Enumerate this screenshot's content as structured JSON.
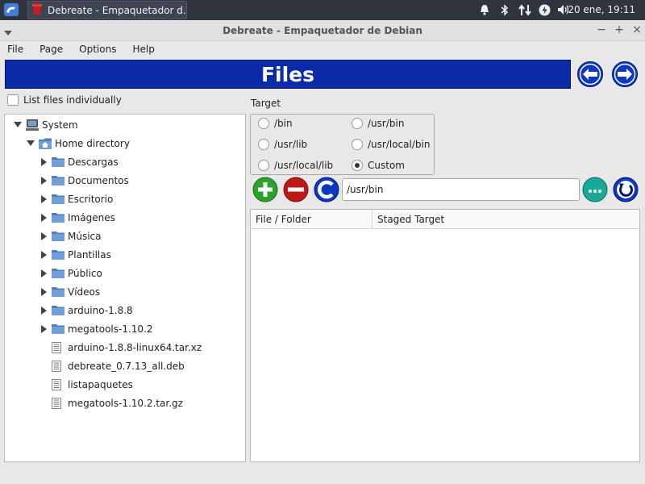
{
  "panel": {
    "task_label": "Debreate - Empaquetador d...",
    "clock": "20 ene, 19:11"
  },
  "window": {
    "title": "Debreate - Empaquetador de Debian",
    "minimize": "−",
    "maximize": "+",
    "close": "×"
  },
  "menubar": {
    "items": [
      "File",
      "Page",
      "Options",
      "Help"
    ]
  },
  "banner": {
    "title": "Files"
  },
  "options": {
    "list_individually": "List files individually"
  },
  "tree": {
    "items": [
      {
        "label": "System",
        "type": "computer",
        "arrow": "expanded"
      },
      {
        "label": "Home directory",
        "type": "home",
        "arrow": "expanded"
      },
      {
        "label": "Descargas",
        "type": "folder",
        "arrow": "collapsed"
      },
      {
        "label": "Documentos",
        "type": "folder",
        "arrow": "collapsed"
      },
      {
        "label": "Escritorio",
        "type": "folder",
        "arrow": "collapsed"
      },
      {
        "label": "Imágenes",
        "type": "folder",
        "arrow": "collapsed"
      },
      {
        "label": "Música",
        "type": "folder",
        "arrow": "collapsed"
      },
      {
        "label": "Plantillas",
        "type": "folder",
        "arrow": "collapsed"
      },
      {
        "label": "Público",
        "type": "folder",
        "arrow": "collapsed"
      },
      {
        "label": "Vídeos",
        "type": "folder",
        "arrow": "collapsed"
      },
      {
        "label": "arduino-1.8.8",
        "type": "folder",
        "arrow": "collapsed"
      },
      {
        "label": "megatools-1.10.2",
        "type": "folder",
        "arrow": "collapsed"
      },
      {
        "label": "arduino-1.8.8-linux64.tar.xz",
        "type": "file",
        "arrow": "none"
      },
      {
        "label": "debreate_0.7.13_all.deb",
        "type": "file",
        "arrow": "none"
      },
      {
        "label": "listapaquetes",
        "type": "file",
        "arrow": "none"
      },
      {
        "label": "megatools-1.10.2.tar.gz",
        "type": "file",
        "arrow": "none"
      }
    ]
  },
  "target": {
    "label": "Target",
    "options": [
      "/bin",
      "/usr/bin",
      "/usr/lib",
      "/usr/local/bin",
      "/usr/local/lib",
      "Custom"
    ],
    "selected": "Custom"
  },
  "path": {
    "value": "/usr/bin"
  },
  "staged": {
    "columns": [
      "File / Folder",
      "Staged Target"
    ]
  },
  "colors": {
    "banner": "#0b2aa8",
    "add": "#2ea02e",
    "remove": "#c01818",
    "accent": "#0c38c4",
    "browse": "#1aa898"
  },
  "icons": {
    "nav_prev": "arrow-left-icon",
    "nav_next": "arrow-right-icon",
    "add": "plus-icon",
    "remove": "minus-icon",
    "clear": "clear-icon",
    "browse": "ellipsis-icon",
    "refresh": "refresh-icon"
  }
}
